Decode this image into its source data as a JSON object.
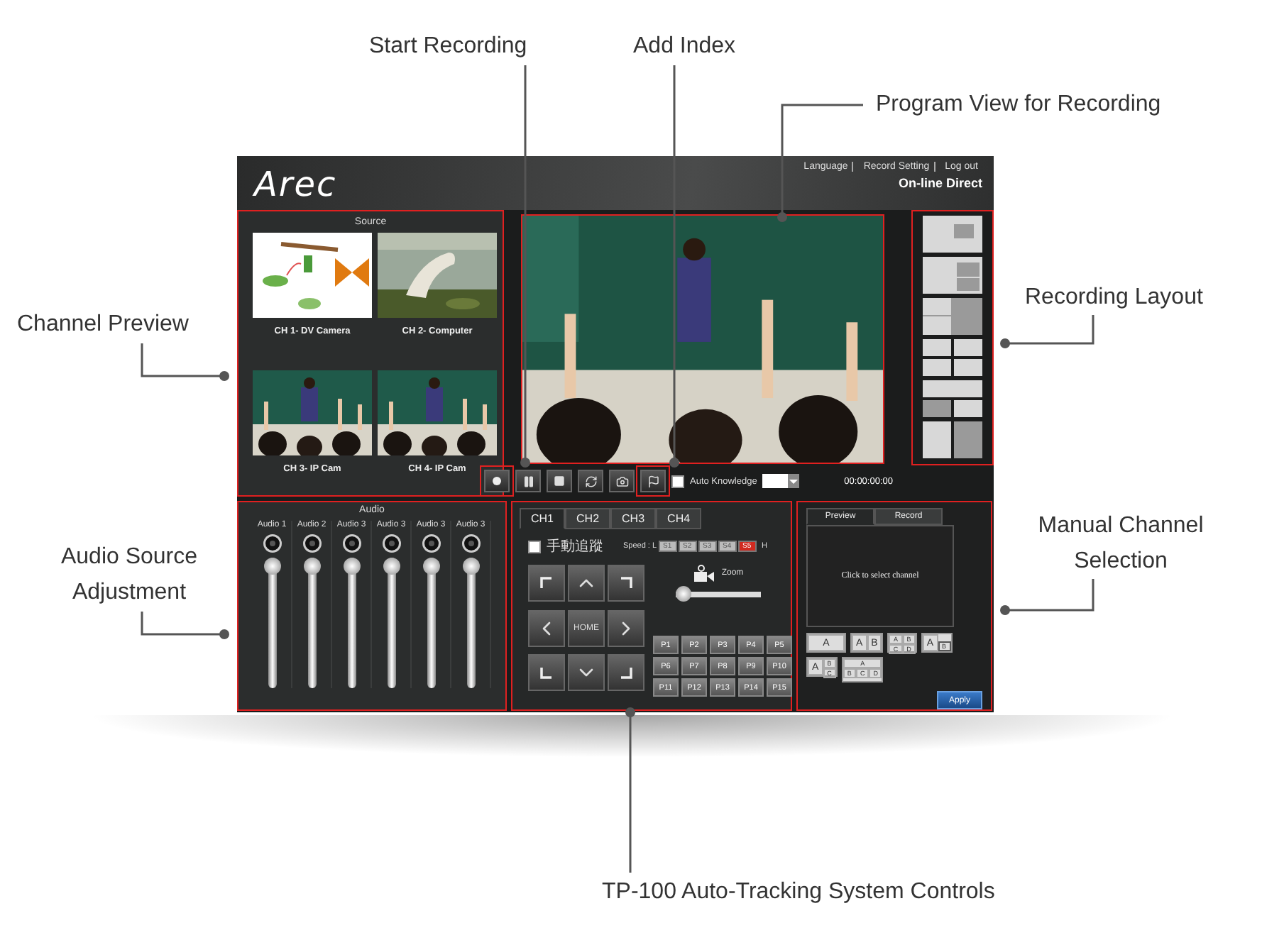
{
  "callouts": [
    {
      "label": "Start Recording"
    },
    {
      "label": "Add Index"
    },
    {
      "label": "Program View for Recording"
    },
    {
      "label": "Channel Preview"
    },
    {
      "label": "Recording Layout"
    },
    {
      "label": "Audio Source Adjustment"
    },
    {
      "label": "Manual Channel Selection"
    },
    {
      "label": "TP-100 Auto-Tracking System Controls"
    }
  ],
  "app": {
    "logo": "Arec",
    "links": [
      "Language",
      "Record Setting",
      "Log out"
    ],
    "mode": "On-line Direct"
  },
  "source": {
    "title": "Source",
    "channels": [
      {
        "label": "CH 1- DV Camera"
      },
      {
        "label": "CH 2- Computer"
      },
      {
        "label": "CH 3- IP Cam"
      },
      {
        "label": "CH 4- IP Cam"
      }
    ]
  },
  "program": {
    "controls": [
      {
        "kind": "record"
      },
      {
        "kind": "pause"
      },
      {
        "kind": "stop"
      },
      {
        "kind": "refresh"
      },
      {
        "kind": "snapshot"
      },
      {
        "kind": "index"
      }
    ],
    "auto_knowledge": {
      "label": "Auto Knowledge",
      "checked": false
    },
    "time": "00:00:00:00"
  },
  "layouts": [
    {
      "kind": "pip"
    },
    {
      "kind": "side"
    },
    {
      "kind": "corner"
    },
    {
      "kind": "quad"
    },
    {
      "kind": "stack"
    },
    {
      "kind": "split"
    }
  ],
  "audio": {
    "title": "Audio",
    "channels": [
      {
        "label": "Audio 1",
        "level": 1
      },
      {
        "label": "Audio 2",
        "level": 1
      },
      {
        "label": "Audio 3",
        "level": 1
      },
      {
        "label": "Audio 3",
        "level": 1
      },
      {
        "label": "Audio 3",
        "level": 1
      },
      {
        "label": "Audio 3",
        "level": 1
      }
    ]
  },
  "tracking": {
    "tabs": [
      {
        "label": "CH1",
        "selected": true
      },
      {
        "label": "CH2",
        "selected": false
      },
      {
        "label": "CH3",
        "selected": false
      },
      {
        "label": "CH4",
        "selected": false
      }
    ],
    "manual": {
      "label": "手動追蹤",
      "checked": false
    },
    "speed_label": "Speed : L",
    "speeds": [
      {
        "label": "S1",
        "selected": false
      },
      {
        "label": "S2",
        "selected": false
      },
      {
        "label": "S3",
        "selected": false
      },
      {
        "label": "S4",
        "selected": false
      },
      {
        "label": "S5",
        "selected": true
      }
    ],
    "speed_high": "H",
    "zoom": {
      "label": "Zoom",
      "level": 0
    },
    "home": "HOME",
    "presets": [
      "P1",
      "P2",
      "P3",
      "P4",
      "P5",
      "P6",
      "P7",
      "P8",
      "P9",
      "P10",
      "P11",
      "P12",
      "P13",
      "P14",
      "P15"
    ]
  },
  "selection": {
    "tabs": [
      {
        "label": "Preview",
        "selected": true
      },
      {
        "label": "Record",
        "selected": false
      }
    ],
    "prompt": "Click to select channel",
    "layouts": [
      {
        "kind": "single",
        "cells": [
          "A"
        ]
      },
      {
        "kind": "side",
        "cells": [
          "A",
          "B"
        ]
      },
      {
        "kind": "quad",
        "cells": [
          "A",
          "B",
          "C",
          "D"
        ]
      },
      {
        "kind": "pip",
        "cells": [
          "A",
          "B"
        ]
      },
      {
        "kind": "split3",
        "cells": [
          "A",
          "B",
          "C"
        ]
      },
      {
        "kind": "top3",
        "cells": [
          "A",
          "B",
          "C",
          "D"
        ]
      }
    ],
    "apply": "Apply"
  }
}
